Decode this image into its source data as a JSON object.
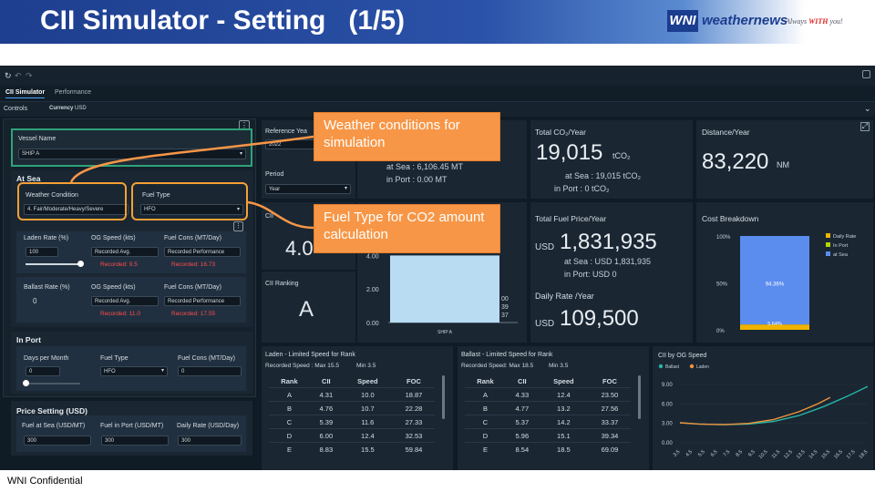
{
  "slide": {
    "title": "CII Simulator - Setting   (1/5)",
    "logo_box": "WNI",
    "logo_text": "weathernews",
    "logo_tag_a": "Always ",
    "logo_tag_b": "WITH",
    "logo_tag_c": " you!",
    "footer": "WNI Confidential"
  },
  "app": {
    "tabs": [
      "CII Simulator",
      "Performance"
    ],
    "controls_label": "Controls",
    "currency_label": "Currency",
    "currency_value": "USD"
  },
  "vessel": {
    "label": "Vessel Name",
    "value": "SHIP A"
  },
  "at_sea": {
    "header": "At Sea",
    "weather_label": "Weather Condition",
    "weather_value": "4. Fair/Moderate/Heavy/Severe",
    "fuel_label": "Fuel Type",
    "fuel_value": "HFO",
    "laden_rate_label": "Laden Rate (%)",
    "laden_rate_value": "100",
    "laden_slider_level": 1.0,
    "og_speed_label": "OG Speed (kts)",
    "og_speed_value": "Recorded Avg.",
    "laden_recorded_speed": "Recorded: 9.5",
    "fuel_cons_label": "Fuel Cons (MT/Day)",
    "fuel_cons_value": "Recorded Performance",
    "laden_recorded_cons": "Recorded: 16.73",
    "ballast_rate_label": "Ballast Rate (%)",
    "ballast_rate_value": "0",
    "ballast_recorded_speed": "Recorded: 11.0",
    "ballast_recorded_cons": "Recorded: 17.55"
  },
  "in_port": {
    "header": "In Port",
    "days_label": "Days per Month",
    "days_value": "0",
    "days_slider_level": 0.0,
    "fuel_label": "Fuel Type",
    "fuel_value": "HFO",
    "cons_label": "Fuel Cons (MT/Day)",
    "cons_value": "0"
  },
  "price": {
    "header": "Price Setting (USD)",
    "sea_label": "Fuel at Sea (USD/MT)",
    "sea_value": "300",
    "port_label": "Fuel in Port (USD/MT)",
    "port_value": "300",
    "daily_label": "Daily Rate (USD/Day)",
    "daily_value": "300"
  },
  "reference": {
    "label": "Reference Yea",
    "value": "2022"
  },
  "period": {
    "label": "Period",
    "value": "Year"
  },
  "fuel_consumed": {
    "sea": "at Sea : 6,106.45 MT",
    "port": "in Port : 0.00 MT"
  },
  "co2": {
    "title": "Total CO₂/Year",
    "value": "19,015",
    "unit": "tCO₂",
    "sea": "at Sea : 19,015 tCO₂",
    "port": "in Port : 0 tCO₂"
  },
  "distance": {
    "title": "Distance/Year",
    "value": "83,220",
    "unit": "NM"
  },
  "cii": {
    "label": "CII",
    "value": "4.0",
    "ranking_label": "CII Ranking",
    "ranking_value": "A"
  },
  "mini_bar": {
    "ticks": [
      "4.00",
      "2.00",
      "0.00"
    ],
    "category": "SHIP A",
    "value": 4.0,
    "ymax": 5.0,
    "right_labels": [
      "00",
      "39",
      "37"
    ]
  },
  "fuel_price": {
    "title": "Total Fuel Price/Year",
    "currency": "USD",
    "value": "1,831,935",
    "sea": "at Sea : USD 1,831,935",
    "port": "in Port: USD 0"
  },
  "daily_rate": {
    "title": "Daily Rate /Year",
    "currency": "USD",
    "value": "109,500"
  },
  "cost": {
    "title": "Cost Breakdown",
    "ticks": [
      "100%",
      "50%",
      "0%"
    ],
    "legend": [
      {
        "label": "Daily Rate",
        "color": "#f0b400"
      },
      {
        "label": "In Port",
        "color": "#b6d300"
      },
      {
        "label": "at Sea",
        "color": "#5b8def"
      }
    ],
    "sea_pct": 94.36,
    "rate_pct": 5.64,
    "sea_label": "94.36%",
    "rate_label": "5.64%"
  },
  "laden_table": {
    "title": "Laden - Limited Speed for Rank",
    "recorded": "Recorded Speed : Max 15.5",
    "min": "Min 3.5",
    "headers": [
      "Rank",
      "CII",
      "Speed",
      "FOC"
    ],
    "rows": [
      [
        "A",
        "4.31",
        "10.0",
        "18.87"
      ],
      [
        "B",
        "4.76",
        "10.7",
        "22.28"
      ],
      [
        "C",
        "5.39",
        "11.6",
        "27.33"
      ],
      [
        "D",
        "6.00",
        "12.4",
        "32.53"
      ],
      [
        "E",
        "8.83",
        "15.5",
        "59.84"
      ]
    ]
  },
  "ballast_table": {
    "title": "Ballast - Limited Speed for Rank",
    "recorded": "Recorded Speed: Max 18.5",
    "min": "Min 3.5",
    "headers": [
      "Rank",
      "CII",
      "Speed",
      "FOC"
    ],
    "rows": [
      [
        "A",
        "4.33",
        "12.4",
        "23.50"
      ],
      [
        "B",
        "4.77",
        "13.2",
        "27.56"
      ],
      [
        "C",
        "5.37",
        "14.2",
        "33.37"
      ],
      [
        "D",
        "5.96",
        "15.1",
        "39.34"
      ],
      [
        "E",
        "8.54",
        "18.5",
        "69.09"
      ]
    ]
  },
  "og_chart": {
    "title": "CII by OG Speed",
    "legend": [
      {
        "label": "Ballast",
        "color": "#27b5a5"
      },
      {
        "label": "Laden",
        "color": "#f0923a"
      }
    ],
    "y_ticks": [
      "9.00",
      "6.00",
      "3.00",
      "0.00"
    ],
    "x_ticks": [
      "3.5",
      "4.5",
      "5.5",
      "6.5",
      "7.5",
      "8.5",
      "9.5",
      "10.5",
      "11.5",
      "12.5",
      "13.5",
      "14.5",
      "15.5",
      "16.5",
      "17.5",
      "18.5"
    ]
  },
  "callouts": {
    "weather": "Weather conditions for simulation",
    "fuel": "Fuel Type for CO2 amount calculation"
  },
  "colors": {
    "accent": "#f79646",
    "app_bg": "#0f1b25",
    "panel": "#1a2733",
    "red": "#ff4d4d"
  }
}
